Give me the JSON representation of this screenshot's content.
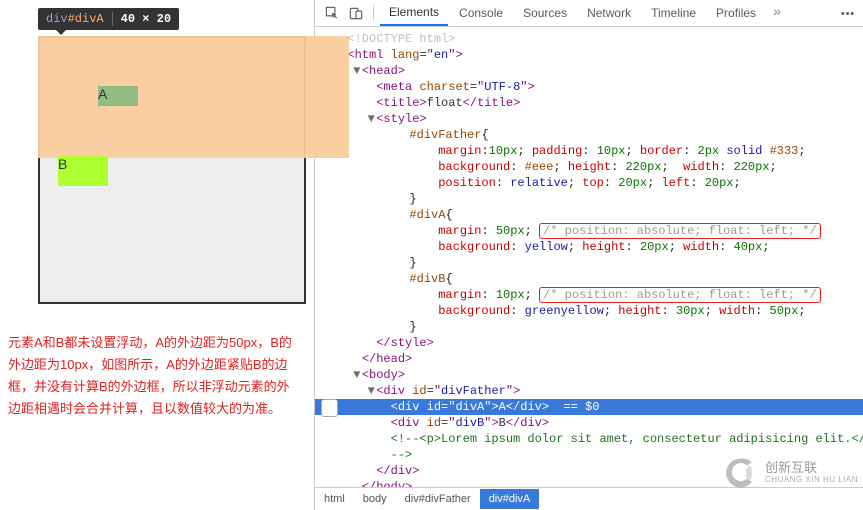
{
  "tooltip": {
    "tag": "div",
    "id": "#divA",
    "dimensions": "40 × 20"
  },
  "preview": {
    "labels": {
      "a": "A",
      "b": "B"
    }
  },
  "caption": "元素A和B都未设置浮动，A的外边距为50px，B的外边距为10px，如图所示，A的外边距紧贴B的边框，并没有计算B的外边框，所以非浮动元素的外边距相遇时会合并计算，且以数值较大的为准。",
  "tabs": {
    "items": [
      "Elements",
      "Console",
      "Sources",
      "Network",
      "Timeline",
      "Profiles"
    ],
    "active": 0,
    "more": "»"
  },
  "source": {
    "doctype": "<!DOCTYPE html>",
    "htmlAttr": {
      "lang": "en"
    },
    "headMeta": {
      "charset": "UTF-8"
    },
    "title": "float",
    "style": {
      "selectors": {
        "father": "#divFather",
        "a": "#divA",
        "b": "#divB"
      },
      "father": "margin:10px; padding: 10px; border: 2px solid #333;\nbackground: #eee; height: 220px;  width: 220px;\nposition: relative; top: 20px; left: 20px;",
      "a": {
        "line1": "margin: 50px;",
        "comment": "/* position: absolute; float: left; */",
        "line2": "background: yellow; height: 20px; width: 40px;"
      },
      "b": {
        "line1": "margin: 10px;",
        "comment": "/* position: absolute; float: left; */",
        "line2": "background: greenyellow; height: 30px; width: 50px;"
      }
    },
    "body": {
      "father": {
        "id": "divFather"
      },
      "a": {
        "id": "divA",
        "text": "A",
        "consoleHint": "== $0"
      },
      "b": {
        "id": "divB",
        "text": "B"
      },
      "comment": "<!--<p>Lorem ipsum dolor sit amet, consectetur adipisicing elit.</p>-->"
    }
  },
  "crumbs": [
    "html",
    "body",
    "div#divFather",
    "div#divA"
  ],
  "watermark": {
    "zh": "创新互联",
    "en": "CHUANG XIN HU LIAN"
  }
}
